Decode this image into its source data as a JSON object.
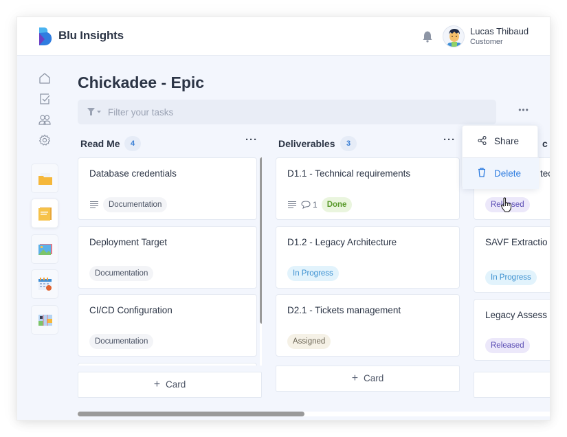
{
  "app": {
    "brand": "Blu Insights",
    "brand_colors": {
      "primary": "#2f7de0",
      "secondary": "#6b3fc4"
    }
  },
  "user": {
    "name": "Lucas Thibaud",
    "role": "Customer",
    "notification_icon": "bell-icon"
  },
  "sidebar": {
    "nav": [
      {
        "name": "home",
        "icon": "home-icon"
      },
      {
        "name": "tasks",
        "icon": "checkbox-icon"
      },
      {
        "name": "team",
        "icon": "users-icon"
      },
      {
        "name": "settings",
        "icon": "gear-icon"
      }
    ],
    "apps": [
      {
        "name": "folder",
        "icon": "folder-app-icon",
        "active": false
      },
      {
        "name": "notes",
        "icon": "notes-app-icon",
        "active": true
      },
      {
        "name": "gallery",
        "icon": "image-app-icon",
        "active": false
      },
      {
        "name": "calendar",
        "icon": "calendar-app-icon",
        "active": false
      },
      {
        "name": "map",
        "icon": "map-app-icon",
        "active": false
      }
    ]
  },
  "page": {
    "title": "Chickadee - Epic",
    "filter_placeholder": "Filter your tasks",
    "filter_value": ""
  },
  "columns": [
    {
      "title": "Read Me",
      "count": "4",
      "cards": [
        {
          "title": "Database credentials",
          "has_description": true,
          "tag": "Documentation",
          "tag_type": "doc"
        },
        {
          "title": "Deployment Target",
          "has_description": false,
          "tag": "Documentation",
          "tag_type": "doc"
        },
        {
          "title": "CI/CD Configuration",
          "has_description": false,
          "tag": "Documentation",
          "tag_type": "doc"
        }
      ],
      "add_label": "Card"
    },
    {
      "title": "Deliverables",
      "count": "3",
      "cards": [
        {
          "title": "D1.1 - Technical requirements",
          "has_description": true,
          "comments": "1",
          "tag": "Done",
          "tag_type": "done"
        },
        {
          "title": "D1.2 - Legacy Architecture",
          "has_description": false,
          "tag": "In Progress",
          "tag_type": "progress"
        },
        {
          "title": "D2.1 - Tickets management",
          "has_description": false,
          "tag": "Assigned",
          "tag_type": "assigned"
        }
      ],
      "add_label": "Card"
    },
    {
      "title": "Technic",
      "title_visible": "c",
      "cards": [
        {
          "title": "Legacy Architec",
          "visible_title": "tec",
          "tag": "Released",
          "tag_type": "released"
        },
        {
          "title": "SAVF Extractio",
          "tag": "In Progress",
          "tag_type": "progress"
        },
        {
          "title": "Legacy Assess",
          "tag": "Released",
          "tag_type": "released"
        }
      ]
    }
  ],
  "context_menu": {
    "items": [
      {
        "label": "Share",
        "icon": "share-icon"
      },
      {
        "label": "Delete",
        "icon": "trash-icon",
        "hovered": true
      }
    ]
  },
  "scroll": {
    "horizontal_position_fraction": 0.0,
    "horizontal_visible_fraction": 0.48,
    "readme_vertical_visible_fraction": 0.8
  }
}
